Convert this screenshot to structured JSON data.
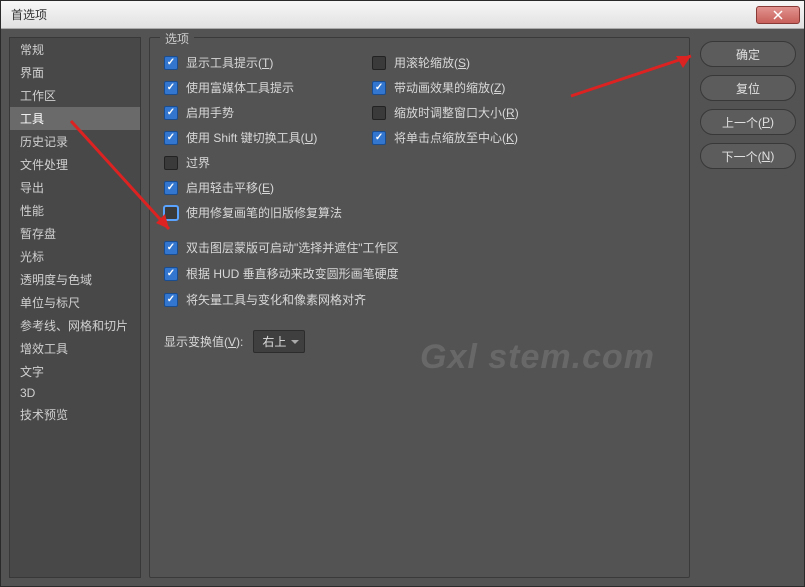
{
  "dialog": {
    "title": "首选项"
  },
  "sidebar": {
    "items": [
      "常规",
      "界面",
      "工作区",
      "工具",
      "历史记录",
      "文件处理",
      "导出",
      "性能",
      "暂存盘",
      "光标",
      "透明度与色域",
      "单位与标尺",
      "参考线、网格和切片",
      "增效工具",
      "文字",
      "3D",
      "技术预览"
    ],
    "selected_index": 3
  },
  "panel": {
    "title": "选项",
    "left_col": [
      {
        "checked": true,
        "label_pre": "显示工具提示(",
        "key": "T",
        "label_post": ")"
      },
      {
        "checked": true,
        "label_pre": "使用富媒体工具提示",
        "key": "",
        "label_post": ""
      },
      {
        "checked": true,
        "label_pre": "启用手势",
        "key": "",
        "label_post": ""
      },
      {
        "checked": true,
        "label_pre": "使用 Shift 键切换工具(",
        "key": "U",
        "label_post": ")"
      },
      {
        "checked": false,
        "label_pre": "过界",
        "key": "",
        "label_post": ""
      },
      {
        "checked": true,
        "label_pre": "启用轻击平移(",
        "key": "E",
        "label_post": ")"
      },
      {
        "checked": false,
        "label_pre": "使用修复画笔的旧版修复算法",
        "key": "",
        "label_post": "",
        "highlighted": true
      }
    ],
    "right_col": [
      {
        "checked": false,
        "label_pre": "用滚轮缩放(",
        "key": "S",
        "label_post": ")"
      },
      {
        "checked": true,
        "label_pre": "带动画效果的缩放(",
        "key": "Z",
        "label_post": ")"
      },
      {
        "checked": false,
        "label_pre": "缩放时调整窗口大小(",
        "key": "R",
        "label_post": ")"
      },
      {
        "checked": true,
        "label_pre": "将单击点缩放至中心(",
        "key": "K",
        "label_post": ")"
      }
    ],
    "extra": [
      {
        "checked": true,
        "label": "双击图层蒙版可启动\"选择并遮住\"工作区"
      },
      {
        "checked": true,
        "label": "根据 HUD 垂直移动来改变圆形画笔硬度"
      },
      {
        "checked": true,
        "label": "将矢量工具与变化和像素网格对齐"
      }
    ],
    "dropdown": {
      "label_pre": "显示变换值(",
      "key": "V",
      "label_post": "):",
      "value": "右上"
    }
  },
  "buttons": {
    "ok": "确定",
    "reset": "复位",
    "prev_pre": "上一个(",
    "prev_key": "P",
    "prev_post": ")",
    "next_pre": "下一个(",
    "next_key": "N",
    "next_post": ")"
  },
  "watermark": "Gxl stem.com"
}
